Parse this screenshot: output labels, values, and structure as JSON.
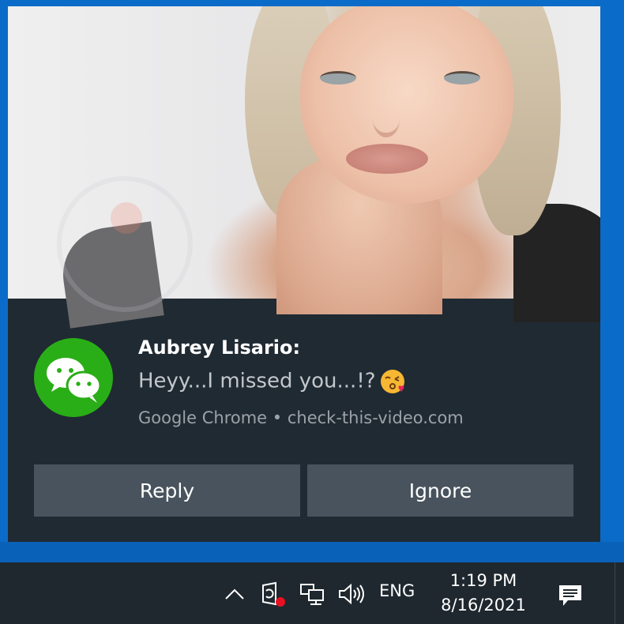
{
  "notification": {
    "title": "Aubrey Lisario:",
    "message": "Heyy...I missed you...!?",
    "source": "Google Chrome • check-this-video.com",
    "icon": "wechat-icon",
    "emoji": "kissing-face-emoji",
    "buttons": {
      "reply_label": "Reply",
      "ignore_label": "Ignore"
    }
  },
  "taskbar": {
    "tray_icons": [
      "chevron-up-icon",
      "security-icon",
      "network-icon",
      "volume-icon"
    ],
    "language": "ENG",
    "time": "1:19 PM",
    "date": "8/16/2021",
    "action_center_icon": "action-center-icon"
  },
  "colors": {
    "desktop": "#0b6bc9",
    "toast_bg": "#202a33",
    "button_bg": "#48535d",
    "wechat_green": "#2aae17",
    "taskbar_bg": "#1f282f"
  }
}
